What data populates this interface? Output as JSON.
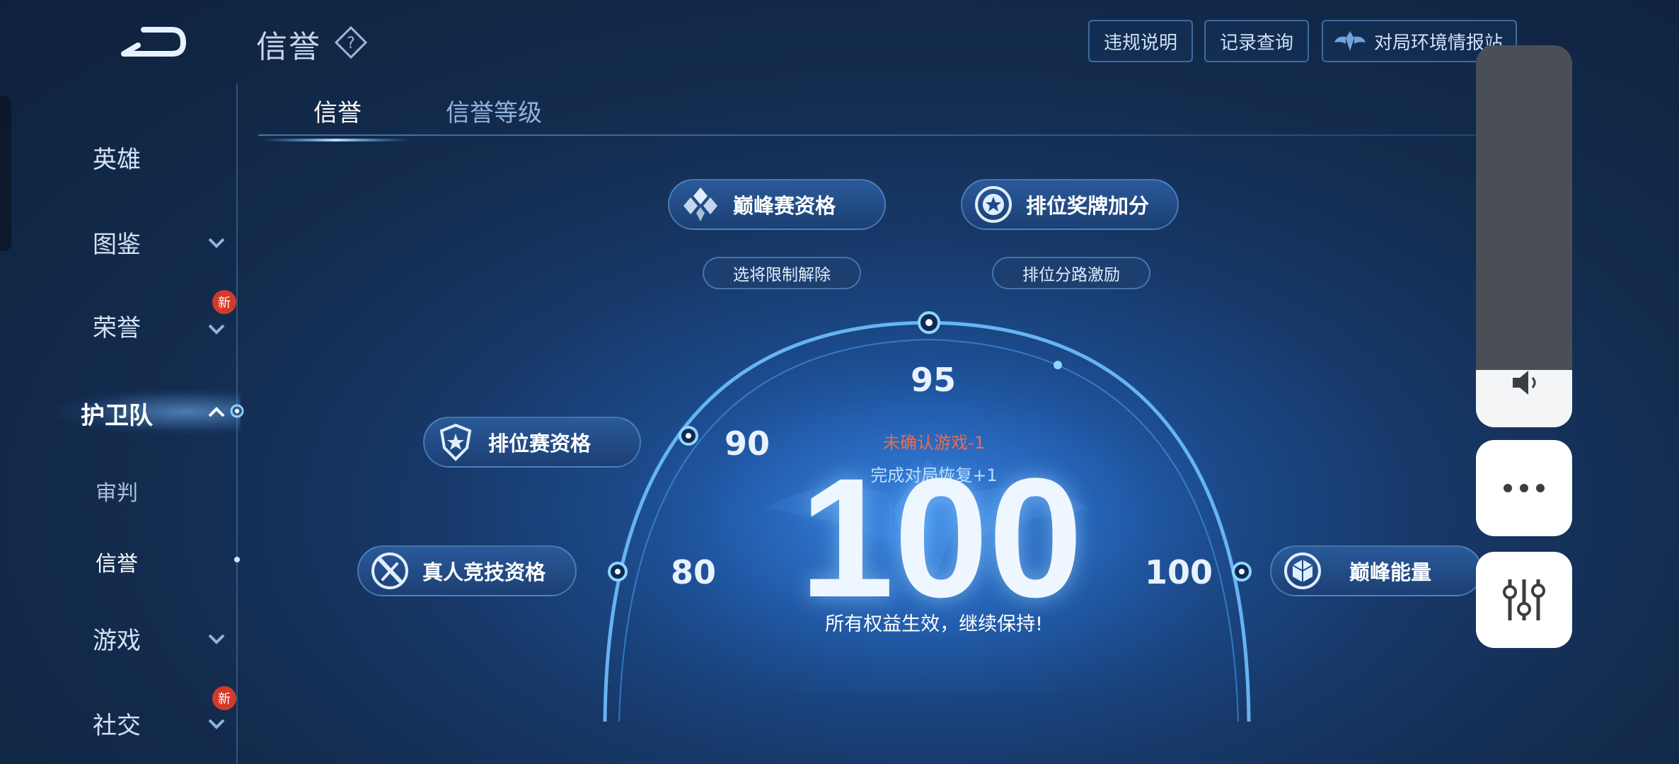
{
  "header": {
    "title": "信誉",
    "buttons": [
      "违规说明",
      "记录查询",
      "对局环境情报站"
    ]
  },
  "tabs": [
    {
      "label": "信誉",
      "active": true
    },
    {
      "label": "信誉等级",
      "active": false
    }
  ],
  "sidebar": {
    "items": [
      {
        "label": "英雄",
        "has_chevron": false,
        "badge": ""
      },
      {
        "label": "图鉴",
        "has_chevron": true,
        "badge": ""
      },
      {
        "label": "荣誉",
        "has_chevron": true,
        "badge": "新"
      },
      {
        "label": "护卫队",
        "has_chevron": true,
        "badge": "",
        "expanded": true,
        "active": true
      },
      {
        "label": "审判",
        "sub": true
      },
      {
        "label": "信誉",
        "sub": true,
        "selected": true
      },
      {
        "label": "游戏",
        "has_chevron": true,
        "badge": ""
      },
      {
        "label": "社交",
        "has_chevron": true,
        "badge": "新"
      }
    ]
  },
  "perks": {
    "peak_match": "巅峰赛资格",
    "rank_medal": "排位奖牌加分",
    "pick_unlock": "选将限制解除",
    "rank_lane": "排位分路激励",
    "ranked": "排位赛资格",
    "real_person": "真人竞技资格",
    "peak_energy": "巅峰能量"
  },
  "gauge": {
    "ticks": [
      "80",
      "90",
      "95",
      "100"
    ],
    "score": "100",
    "penalty_text": "未确认游戏-1",
    "recover_text": "完成对局恢复+1",
    "status_text": "所有权益生效，继续保持!"
  },
  "overlay": {
    "volume_level": 0.15
  },
  "colors": {
    "accent": "#6fc0ff",
    "warning": "#f06a4a",
    "badge": "#d23a2a"
  }
}
